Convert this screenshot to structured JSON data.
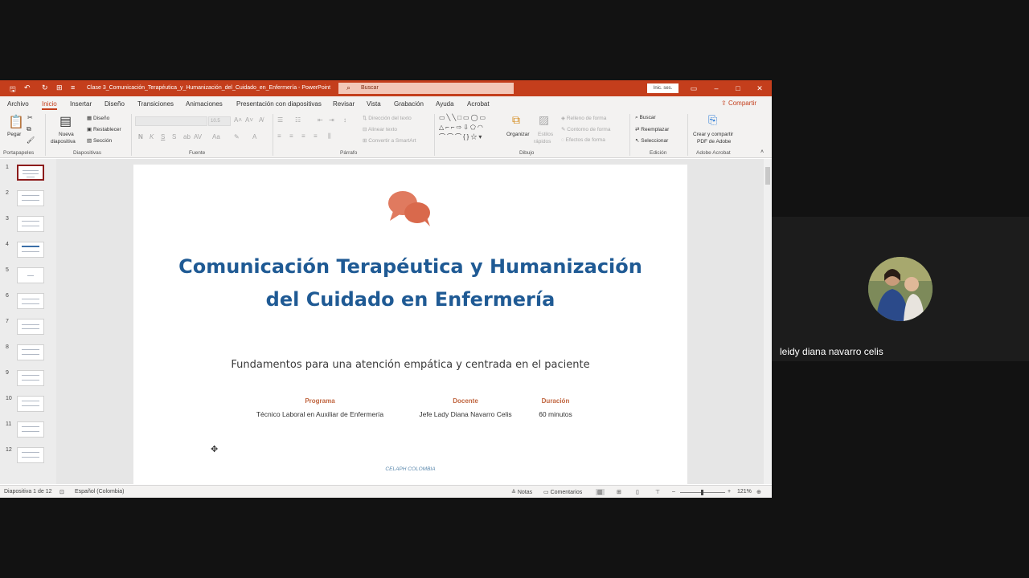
{
  "window": {
    "title": "Clase 3_Comunicación_Terapéutica_y_Humanización_del_Cuidado_en_Enfermería  -  PowerPoint",
    "search_placeholder": "Buscar",
    "signin_label": "Inic. ses."
  },
  "tabs": [
    "Archivo",
    "Inicio",
    "Insertar",
    "Diseño",
    "Transiciones",
    "Animaciones",
    "Presentación con diapositivas",
    "Revisar",
    "Vista",
    "Grabación",
    "Ayuda",
    "Acrobat"
  ],
  "share_label": "Compartir",
  "ribbon": {
    "paste": "Pegar",
    "new_slide_1": "Nueva",
    "new_slide_2": "diapositiva",
    "design": "Diseño",
    "reset": "Restablecer",
    "section": "Sección",
    "font_size": "10.5",
    "text_direction": "Dirección del texto",
    "align_text": "Alinear texto",
    "convert_smartart": "Convertir a SmartArt",
    "organize": "Organizar",
    "quick_styles_1": "Estilos",
    "quick_styles_2": "rápidos",
    "shape_fill": "Relleno de forma",
    "shape_outline": "Contorno de forma",
    "shape_effects": "Efectos de forma",
    "find": "Buscar",
    "replace": "Reemplazar",
    "select": "Seleccionar",
    "acrobat_1": "Crear y compartir",
    "acrobat_2": "PDF de Adobe",
    "groups": {
      "clipboard": "Portapapeles",
      "slides": "Diapositivas",
      "font": "Fuente",
      "paragraph": "Párrafo",
      "drawing": "Dibujo",
      "editing": "Edición",
      "adobe": "Adobe Acrobat"
    }
  },
  "thumbnails": [
    "1",
    "2",
    "3",
    "4",
    "5",
    "6",
    "7",
    "8",
    "9",
    "10",
    "11",
    "12"
  ],
  "selected_thumbnail": "1",
  "slide": {
    "title_line1": "Comunicación Terapéutica y Humanización",
    "title_line2": "del Cuidado en Enfermería",
    "subtitle": "Fundamentos para una atención empática y centrada en el paciente",
    "program_label": "Programa",
    "program_value": "Técnico Laboral en Auxiliar de Enfermería",
    "teacher_label": "Docente",
    "teacher_value": "Jefe Lady Diana Navarro Celis",
    "duration_label": "Duración",
    "duration_value": "60 minutos",
    "footer": "CELAPH COLOMBIA",
    "accent_color": "#e07a5f",
    "title_color": "#1f5a94"
  },
  "statusbar": {
    "slide_info": "Diapositiva 1 de 12",
    "language": "Español (Colombia)",
    "notes": "Notas",
    "comments": "Comentarios",
    "zoom": "121%"
  },
  "participant": {
    "name": "leidy diana navarro celis"
  },
  "colors": {
    "titlebar": "#c43e1c",
    "ribbon_bg": "#f3f2f1",
    "background": "#121212"
  }
}
